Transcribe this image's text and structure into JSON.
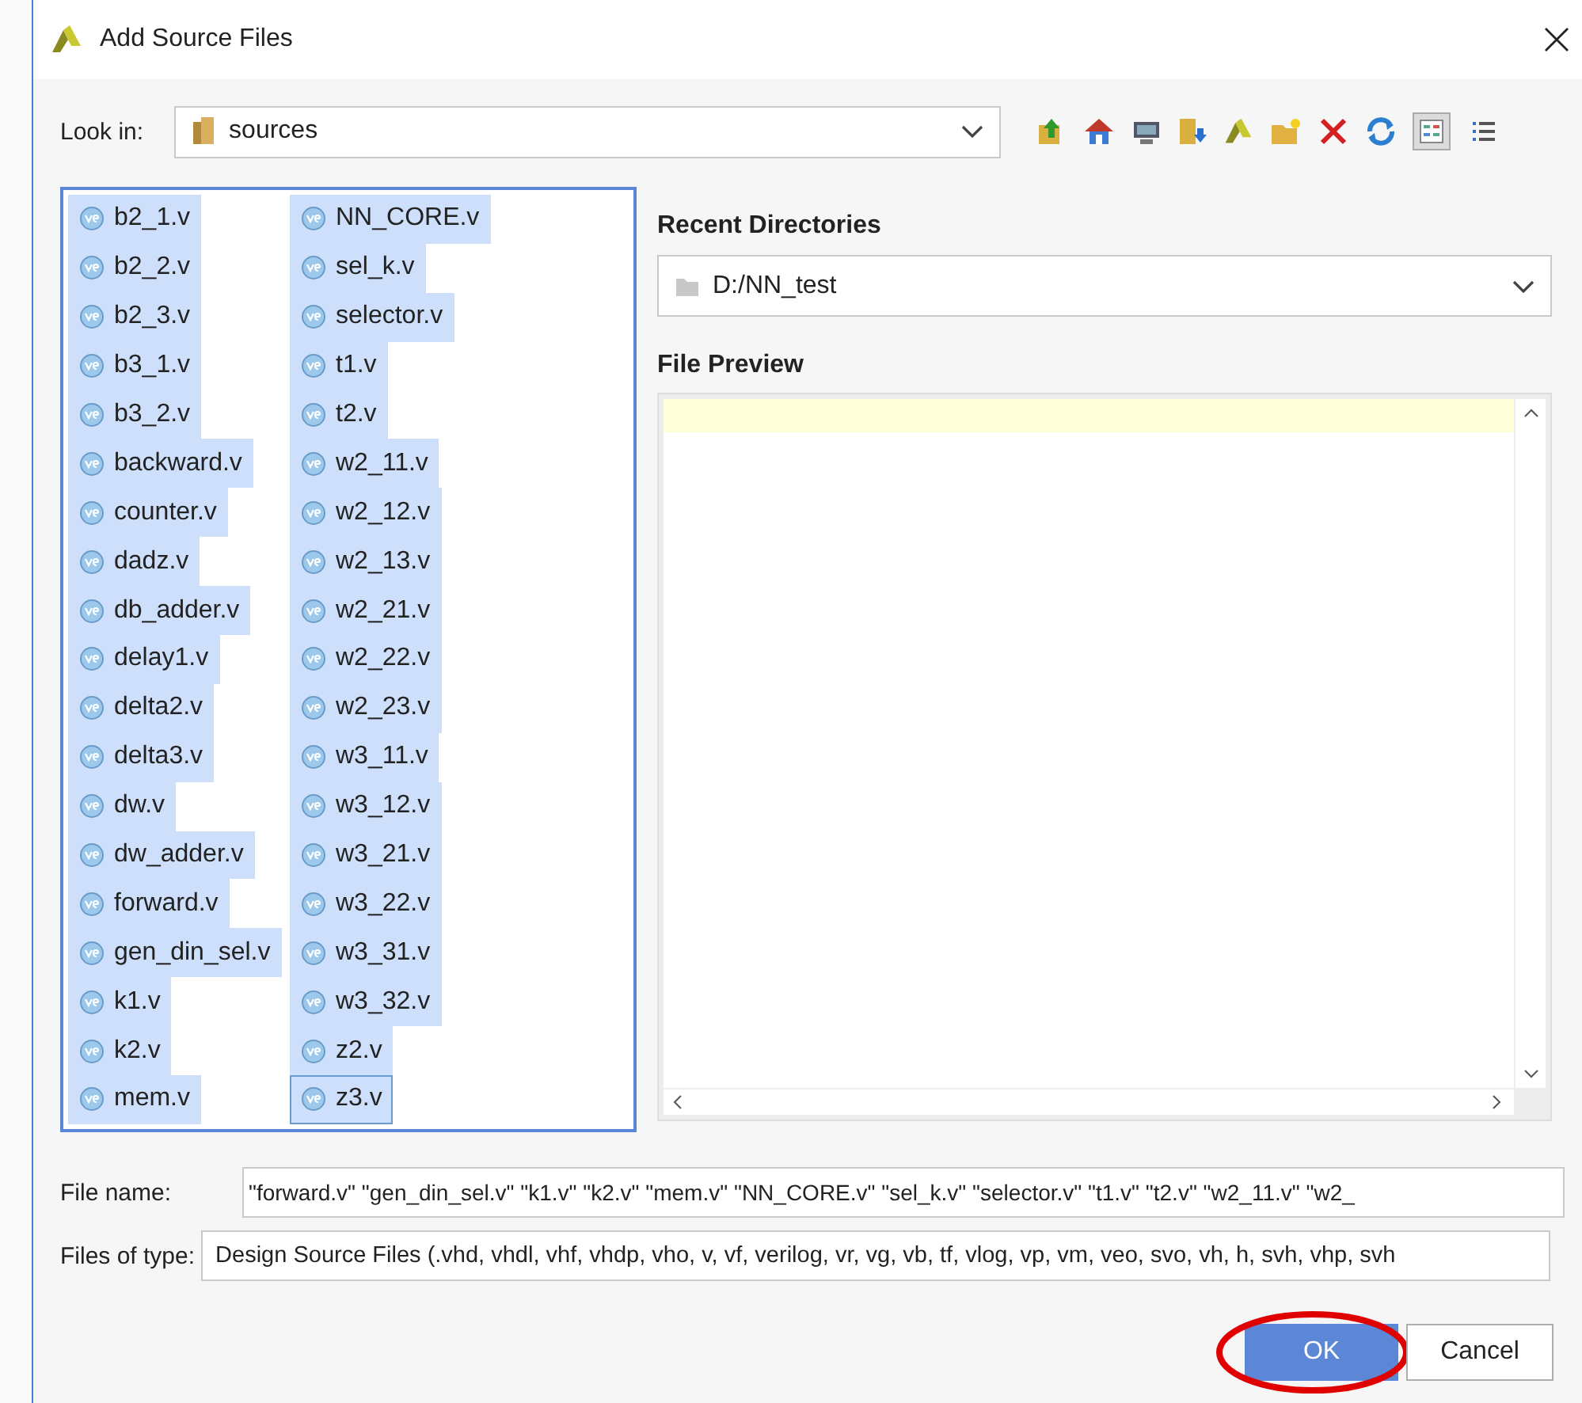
{
  "window": {
    "title": "Add Source Files"
  },
  "look_in": {
    "label": "Look in:",
    "value": "sources"
  },
  "view_modes": [
    {
      "kind": "list",
      "selected": true
    },
    {
      "kind": "details",
      "selected": false
    }
  ],
  "files": [
    {
      "name": "b2_1.v",
      "selected": true,
      "focused": false
    },
    {
      "name": "b2_2.v",
      "selected": true,
      "focused": false
    },
    {
      "name": "b2_3.v",
      "selected": true,
      "focused": false
    },
    {
      "name": "b3_1.v",
      "selected": true,
      "focused": false
    },
    {
      "name": "b3_2.v",
      "selected": true,
      "focused": false
    },
    {
      "name": "backward.v",
      "selected": true,
      "focused": false
    },
    {
      "name": "counter.v",
      "selected": true,
      "focused": false
    },
    {
      "name": "dadz.v",
      "selected": true,
      "focused": false
    },
    {
      "name": "db_adder.v",
      "selected": true,
      "focused": false
    },
    {
      "name": "delay1.v",
      "selected": true,
      "focused": false
    },
    {
      "name": "delta2.v",
      "selected": true,
      "focused": false
    },
    {
      "name": "delta3.v",
      "selected": true,
      "focused": false
    },
    {
      "name": "dw.v",
      "selected": true,
      "focused": false
    },
    {
      "name": "dw_adder.v",
      "selected": true,
      "focused": false
    },
    {
      "name": "forward.v",
      "selected": true,
      "focused": false
    },
    {
      "name": "gen_din_sel.v",
      "selected": true,
      "focused": false
    },
    {
      "name": "k1.v",
      "selected": true,
      "focused": false
    },
    {
      "name": "k2.v",
      "selected": true,
      "focused": false
    },
    {
      "name": "mem.v",
      "selected": true,
      "focused": false
    },
    {
      "name": "NN_CORE.v",
      "selected": true,
      "focused": false
    },
    {
      "name": "sel_k.v",
      "selected": true,
      "focused": false
    },
    {
      "name": "selector.v",
      "selected": true,
      "focused": false
    },
    {
      "name": "t1.v",
      "selected": true,
      "focused": false
    },
    {
      "name": "t2.v",
      "selected": true,
      "focused": false
    },
    {
      "name": "w2_11.v",
      "selected": true,
      "focused": false
    },
    {
      "name": "w2_12.v",
      "selected": true,
      "focused": false
    },
    {
      "name": "w2_13.v",
      "selected": true,
      "focused": false
    },
    {
      "name": "w2_21.v",
      "selected": true,
      "focused": false
    },
    {
      "name": "w2_22.v",
      "selected": true,
      "focused": false
    },
    {
      "name": "w2_23.v",
      "selected": true,
      "focused": false
    },
    {
      "name": "w3_11.v",
      "selected": true,
      "focused": false
    },
    {
      "name": "w3_12.v",
      "selected": true,
      "focused": false
    },
    {
      "name": "w3_21.v",
      "selected": true,
      "focused": false
    },
    {
      "name": "w3_22.v",
      "selected": true,
      "focused": false
    },
    {
      "name": "w3_31.v",
      "selected": true,
      "focused": false
    },
    {
      "name": "w3_32.v",
      "selected": true,
      "focused": false
    },
    {
      "name": "z2.v",
      "selected": true,
      "focused": false
    },
    {
      "name": "z3.v",
      "selected": true,
      "focused": true
    }
  ],
  "recent_directories": {
    "heading": "Recent Directories",
    "value": "D:/NN_test"
  },
  "file_preview": {
    "heading": "File Preview"
  },
  "file_name": {
    "label": "File name:",
    "value": "\"forward.v\" \"gen_din_sel.v\" \"k1.v\" \"k2.v\" \"mem.v\" \"NN_CORE.v\" \"sel_k.v\" \"selector.v\" \"t1.v\" \"t2.v\" \"w2_11.v\" \"w2_"
  },
  "files_of_type": {
    "label": "Files of type:",
    "value": "Design Source Files (.vhd, vhdl, vhf, vhdp, vho, v, vf, verilog, vr, vg, vb, tf, vlog, vp, vm, veo, svo, vh, h, svh, vhp, svh"
  },
  "buttons": [
    {
      "label": "OK",
      "kind": "primary",
      "highlighted": true
    },
    {
      "label": "Cancel",
      "kind": "normal",
      "highlighted": false
    }
  ]
}
